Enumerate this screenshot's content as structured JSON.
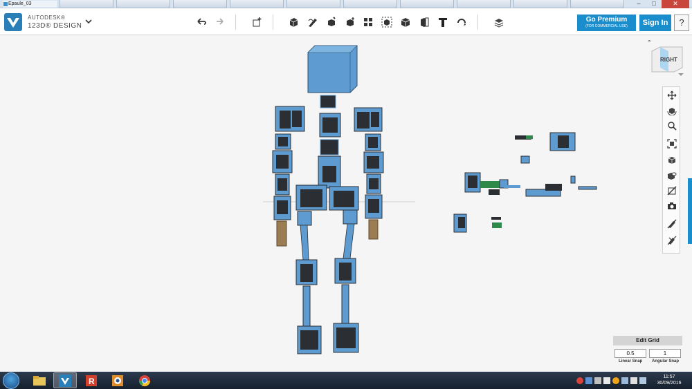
{
  "window": {
    "title": "Epaule_03",
    "controls": [
      "–",
      "□",
      "✕"
    ]
  },
  "app": {
    "brand_line1": "AUTODESK®",
    "brand_line2": "123D® DESIGN",
    "premium_label": "Go Premium",
    "premium_sub": "(FOR COMMERCIAL USE)",
    "signin_label": "Sign In",
    "help_label": "?"
  },
  "toolbar": {
    "icons": [
      "undo-icon",
      "redo-icon",
      "transform-icon",
      "primitives-icon",
      "sketch-icon",
      "construct-icon",
      "modify-icon",
      "pattern-icon",
      "group-icon",
      "combine-icon",
      "measure-icon",
      "text-icon",
      "snap-icon",
      "material-icon"
    ]
  },
  "viewcube": {
    "label": "RIGHT"
  },
  "navbar": {
    "icons": [
      "pan-icon",
      "orbit-icon",
      "zoom-icon",
      "fit-icon",
      "shaded-view-icon",
      "visibility-icon",
      "hide-icon",
      "camera-icon",
      "hide-sketch-icon",
      "hide-mesh-icon"
    ]
  },
  "grid": {
    "title": "Edit Grid",
    "linear_snap": "0.5",
    "linear_label": "Linear Snap",
    "angular_snap": "1",
    "angular_label": "Angular Snap"
  },
  "taskbar": {
    "apps": [
      "explorer-icon",
      "123d-design-icon",
      "roblox-icon",
      "media-icon",
      "chrome-icon"
    ],
    "time": "11:57",
    "date": "30/09/2016"
  },
  "colors": {
    "accent": "#1a8dcd",
    "part_blue": "#5d9bd0",
    "part_dark": "#2b2f33",
    "part_wood": "#9c7d53",
    "part_green": "#2f8a4a"
  }
}
